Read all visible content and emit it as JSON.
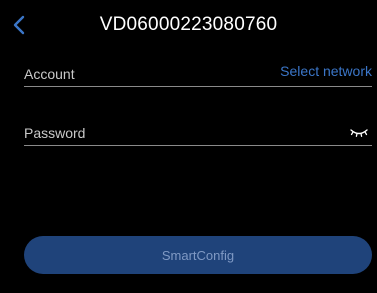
{
  "header": {
    "title": "VD06000223080760",
    "back_icon": "chevron-left-icon"
  },
  "account": {
    "placeholder": "Account",
    "value": "",
    "select_network_label": "Select network"
  },
  "password": {
    "placeholder": "Password",
    "value": "",
    "visibility_icon": "eye-closed-icon"
  },
  "smartconfig": {
    "label": "SmartConfig"
  },
  "colors": {
    "background": "#000000",
    "accent": "#3b76c8",
    "button_bg": "#1f437a",
    "button_text": "#7f99c4",
    "divider": "#8a8a8a"
  }
}
